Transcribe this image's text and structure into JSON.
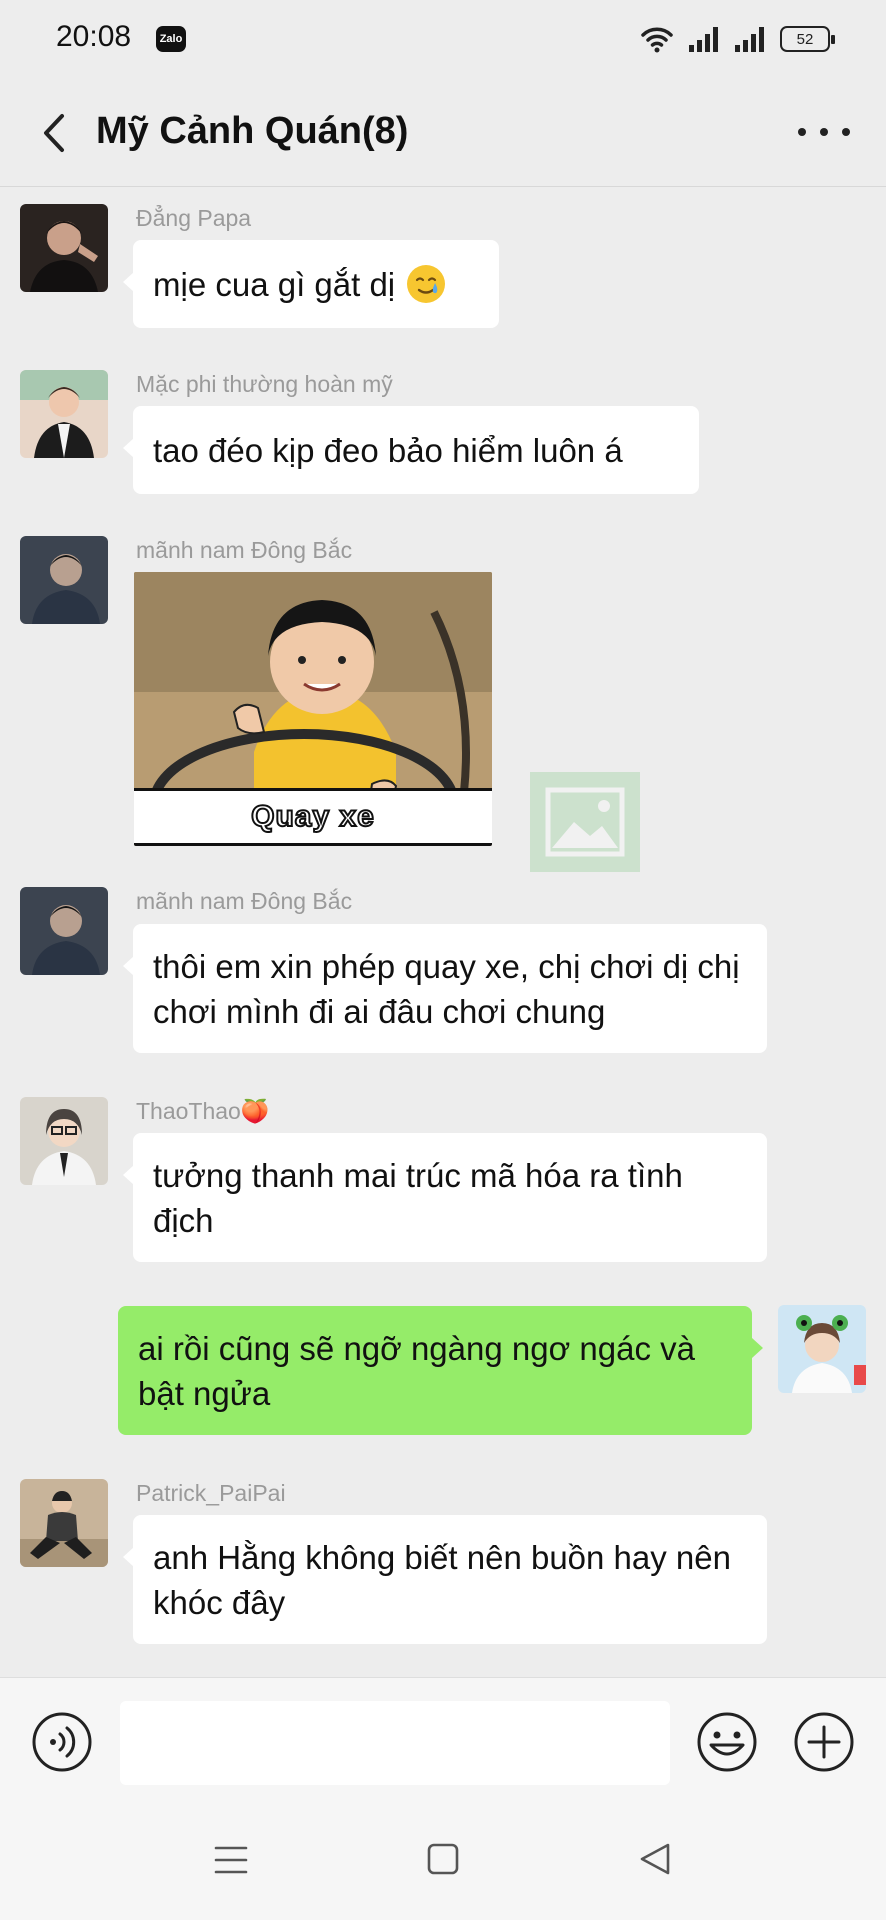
{
  "status_bar": {
    "time": "20:08",
    "app_badge": "Zalo",
    "battery": "52"
  },
  "header": {
    "title": "Mỹ Cảnh Quán(8)"
  },
  "messages": [
    {
      "sender": "Đẳng Papa",
      "text": "mịe cua gì gắt dị",
      "emoji": "smiling-face-with-tear"
    },
    {
      "sender": "Mặc phi thường hoàn mỹ",
      "text": "tao đéo kịp đeo bảo hiểm luôn á"
    },
    {
      "sender": "mãnh nam Đông Bắc",
      "sticker_caption": "Quay xe"
    },
    {
      "sender": "mãnh nam Đông Bắc",
      "text": "thôi em xin phép quay xe, chị chơi dị chị chơi mình đi ai đâu chơi chung"
    },
    {
      "sender": "ThaoThao🍑",
      "text": "tưởng thanh mai trúc mã hóa ra tình địch"
    },
    {
      "sender": "",
      "outgoing": true,
      "text": "ai rồi cũng sẽ ngỡ ngàng ngơ ngác và bật ngửa"
    },
    {
      "sender": "Patrick_PaiPai",
      "text": "anh Hằng không biết nên buồn hay nên khóc đây"
    }
  ],
  "input": {
    "placeholder": "",
    "value": ""
  },
  "colors": {
    "background": "#ededed",
    "outgoing_bubble": "#95ec69",
    "incoming_bubble": "#ffffff"
  }
}
